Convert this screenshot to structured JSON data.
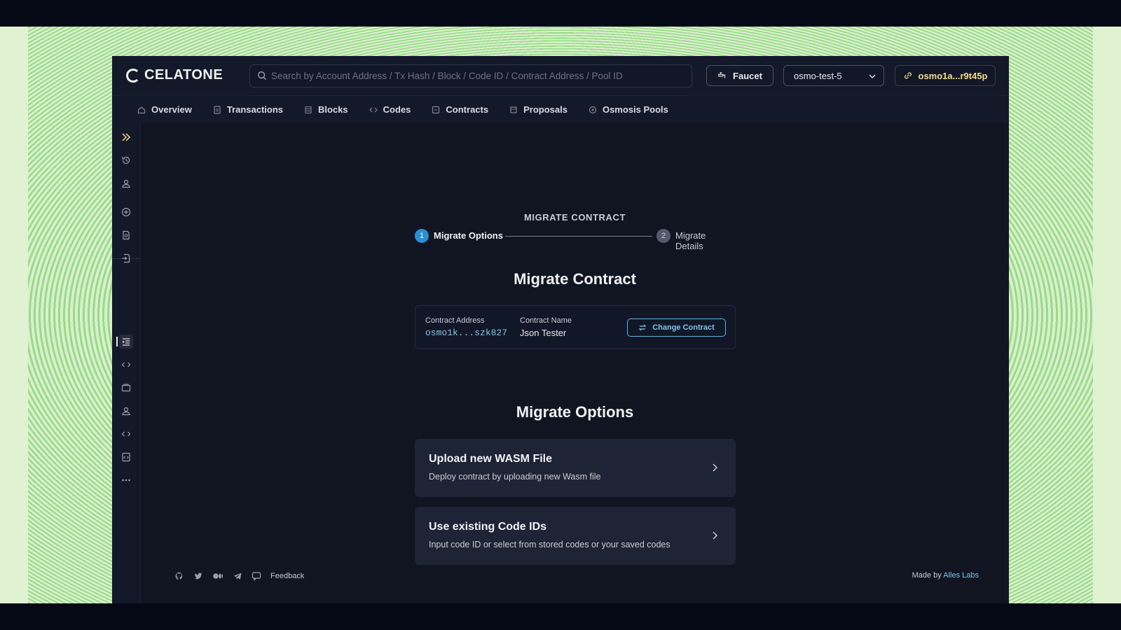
{
  "header": {
    "logo_text": "CELATONE",
    "search_placeholder": "Search by Account Address / Tx Hash / Block / Code ID / Contract Address / Pool ID",
    "faucet_label": "Faucet",
    "network": "osmo-test-5",
    "wallet_address": "osmo1a...r9t45p"
  },
  "nav": {
    "items": [
      {
        "label": "Overview",
        "icon": "home-icon"
      },
      {
        "label": "Transactions",
        "icon": "document-icon"
      },
      {
        "label": "Blocks",
        "icon": "blocks-icon"
      },
      {
        "label": "Codes",
        "icon": "code-icon"
      },
      {
        "label": "Contracts",
        "icon": "contract-icon"
      },
      {
        "label": "Proposals",
        "icon": "proposal-icon"
      },
      {
        "label": "Osmosis Pools",
        "icon": "pool-icon"
      }
    ]
  },
  "sidebar": {
    "icons": [
      "expand-icon",
      "history-icon",
      "account-icon",
      "add-circle-icon",
      "query-icon",
      "execute-icon",
      "migrate-icon",
      "code-icon",
      "wallet-icon",
      "admin-icon",
      "code-icon-2",
      "deploy-icon",
      "more-icon"
    ]
  },
  "stepper": {
    "title": "MIGRATE CONTRACT",
    "steps": [
      {
        "number": "1",
        "label": "Migrate Options",
        "active": true
      },
      {
        "number": "2",
        "label": "Migrate Details",
        "active": false
      }
    ]
  },
  "main": {
    "heading": "Migrate Contract",
    "contract": {
      "address_label": "Contract Address",
      "address_value": "osmo1k...szk827",
      "name_label": "Contract Name",
      "name_value": "Json Tester",
      "change_button": "Change Contract"
    },
    "options_heading": "Migrate Options",
    "options": [
      {
        "title": "Upload new WASM File",
        "description": "Deploy contract by uploading new Wasm file"
      },
      {
        "title": "Use existing Code IDs",
        "description": "Input code ID or select from stored codes or your saved codes"
      }
    ]
  },
  "footer": {
    "feedback_label": "Feedback",
    "made_by_prefix": "Made by",
    "made_by_link": "Alles Labs"
  },
  "colors": {
    "accent": "#7ec3ea",
    "step_active": "#2a8fd2",
    "wallet_text": "#f6d98a",
    "app_bg": "#111522"
  }
}
